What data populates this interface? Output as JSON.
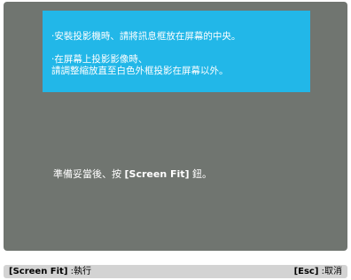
{
  "message": {
    "line1": "·安裝投影機時、請將訊息框放在屏幕的中央。",
    "line2": "·在屏幕上投影影像時、",
    "line3": "請調整縮放直至白色外框投影在屏幕以外。"
  },
  "instruction": {
    "prefix": "準備妥當後、按 ",
    "key": "[Screen Fit]",
    "suffix": " 鈕。"
  },
  "footer": {
    "execute_key": "[Screen Fit]",
    "execute_label": " :執行",
    "cancel_key": "[Esc]",
    "cancel_label": " :取消"
  },
  "colors": {
    "screen_background": "#707570",
    "message_box": "#22b7e8",
    "footer_bar": "#d3d3d3"
  }
}
